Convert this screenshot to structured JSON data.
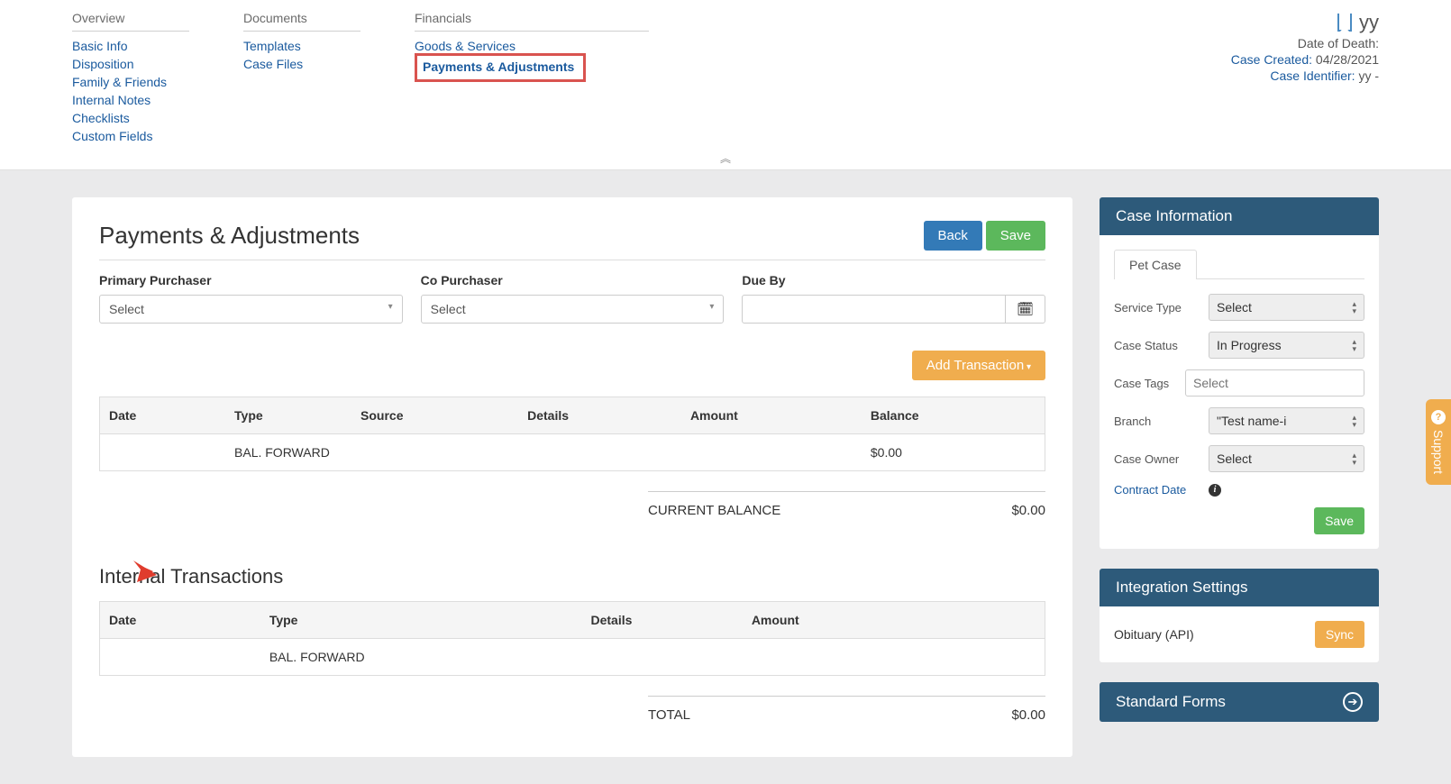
{
  "nav": {
    "overview": {
      "header": "Overview",
      "links": [
        "Basic Info",
        "Disposition",
        "Family & Friends",
        "Internal Notes",
        "Checklists",
        "Custom Fields"
      ]
    },
    "documents": {
      "header": "Documents",
      "links": [
        "Templates",
        "Case Files"
      ]
    },
    "financials": {
      "header": "Financials",
      "goods": "Goods & Services",
      "payments": "Payments & Adjustments"
    }
  },
  "case_summary": {
    "name": "yy",
    "dod_label": "Date of Death:",
    "dod_value": "",
    "created_label": "Case Created:",
    "created_value": "04/28/2021",
    "id_label": "Case Identifier:",
    "id_value": "yy -"
  },
  "page": {
    "title": "Payments & Adjustments",
    "back": "Back",
    "save": "Save",
    "primary_purchaser_label": "Primary Purchaser",
    "co_purchaser_label": "Co Purchaser",
    "due_by_label": "Due By",
    "select_placeholder": "Select",
    "add_transaction": "Add Transaction"
  },
  "table1": {
    "headers": [
      "Date",
      "Type",
      "Source",
      "Details",
      "Amount",
      "Balance"
    ],
    "row_type": "BAL. FORWARD",
    "row_balance": "$0.00",
    "current_balance_label": "CURRENT BALANCE",
    "current_balance_value": "$0.00"
  },
  "internal_section": {
    "title": "Internal Transactions",
    "headers": [
      "Date",
      "Type",
      "Details",
      "Amount"
    ],
    "row_type": "BAL. FORWARD",
    "total_label": "TOTAL",
    "total_value": "$0.00"
  },
  "case_info": {
    "header": "Case Information",
    "tab": "Pet Case",
    "service_type_label": "Service Type",
    "service_type_value": "Select",
    "case_status_label": "Case Status",
    "case_status_value": "In Progress",
    "case_tags_label": "Case Tags",
    "case_tags_placeholder": "Select",
    "branch_label": "Branch",
    "branch_value": "\"Test name-i",
    "case_owner_label": "Case Owner",
    "case_owner_value": "Select",
    "contract_date_label": "Contract Date",
    "save": "Save"
  },
  "integration": {
    "header": "Integration Settings",
    "obit_label": "Obituary (API)",
    "sync": "Sync"
  },
  "forms": {
    "header": "Standard Forms"
  },
  "support": "Support"
}
